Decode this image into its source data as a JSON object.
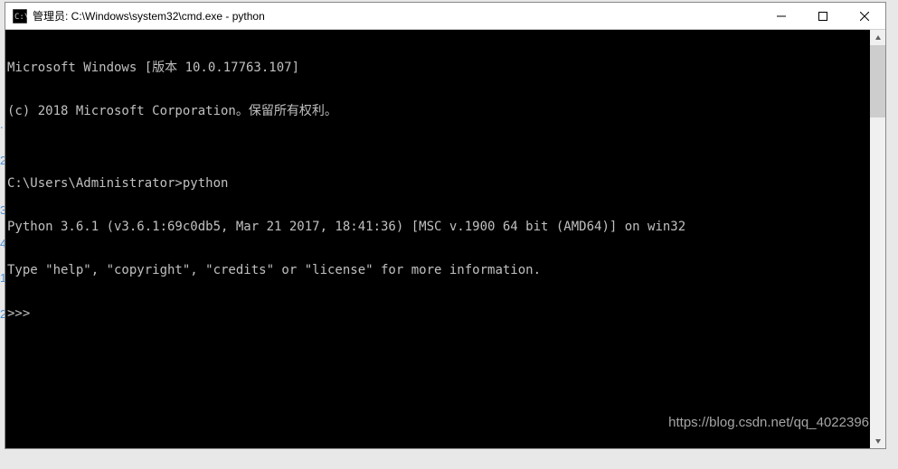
{
  "window": {
    "title": "管理员: C:\\Windows\\system32\\cmd.exe - python"
  },
  "terminal": {
    "lines": [
      "Microsoft Windows [版本 10.0.17763.107]",
      "(c) 2018 Microsoft Corporation。保留所有权利。",
      "",
      "C:\\Users\\Administrator>python",
      "Python 3.6.1 (v3.6.1:69c0db5, Mar 21 2017, 18:41:36) [MSC v.1900 64 bit (AMD64)] on win32",
      "Type \"help\", \"copyright\", \"credits\" or \"license\" for more information.",
      ">>>"
    ]
  },
  "watermark": "https://blog.csdn.net/qq_4022396",
  "bg": {
    "m1": ".",
    "m2": "2.",
    "m3": "3.",
    "m4": "4.",
    "m5": "1.",
    "m6": "2."
  }
}
